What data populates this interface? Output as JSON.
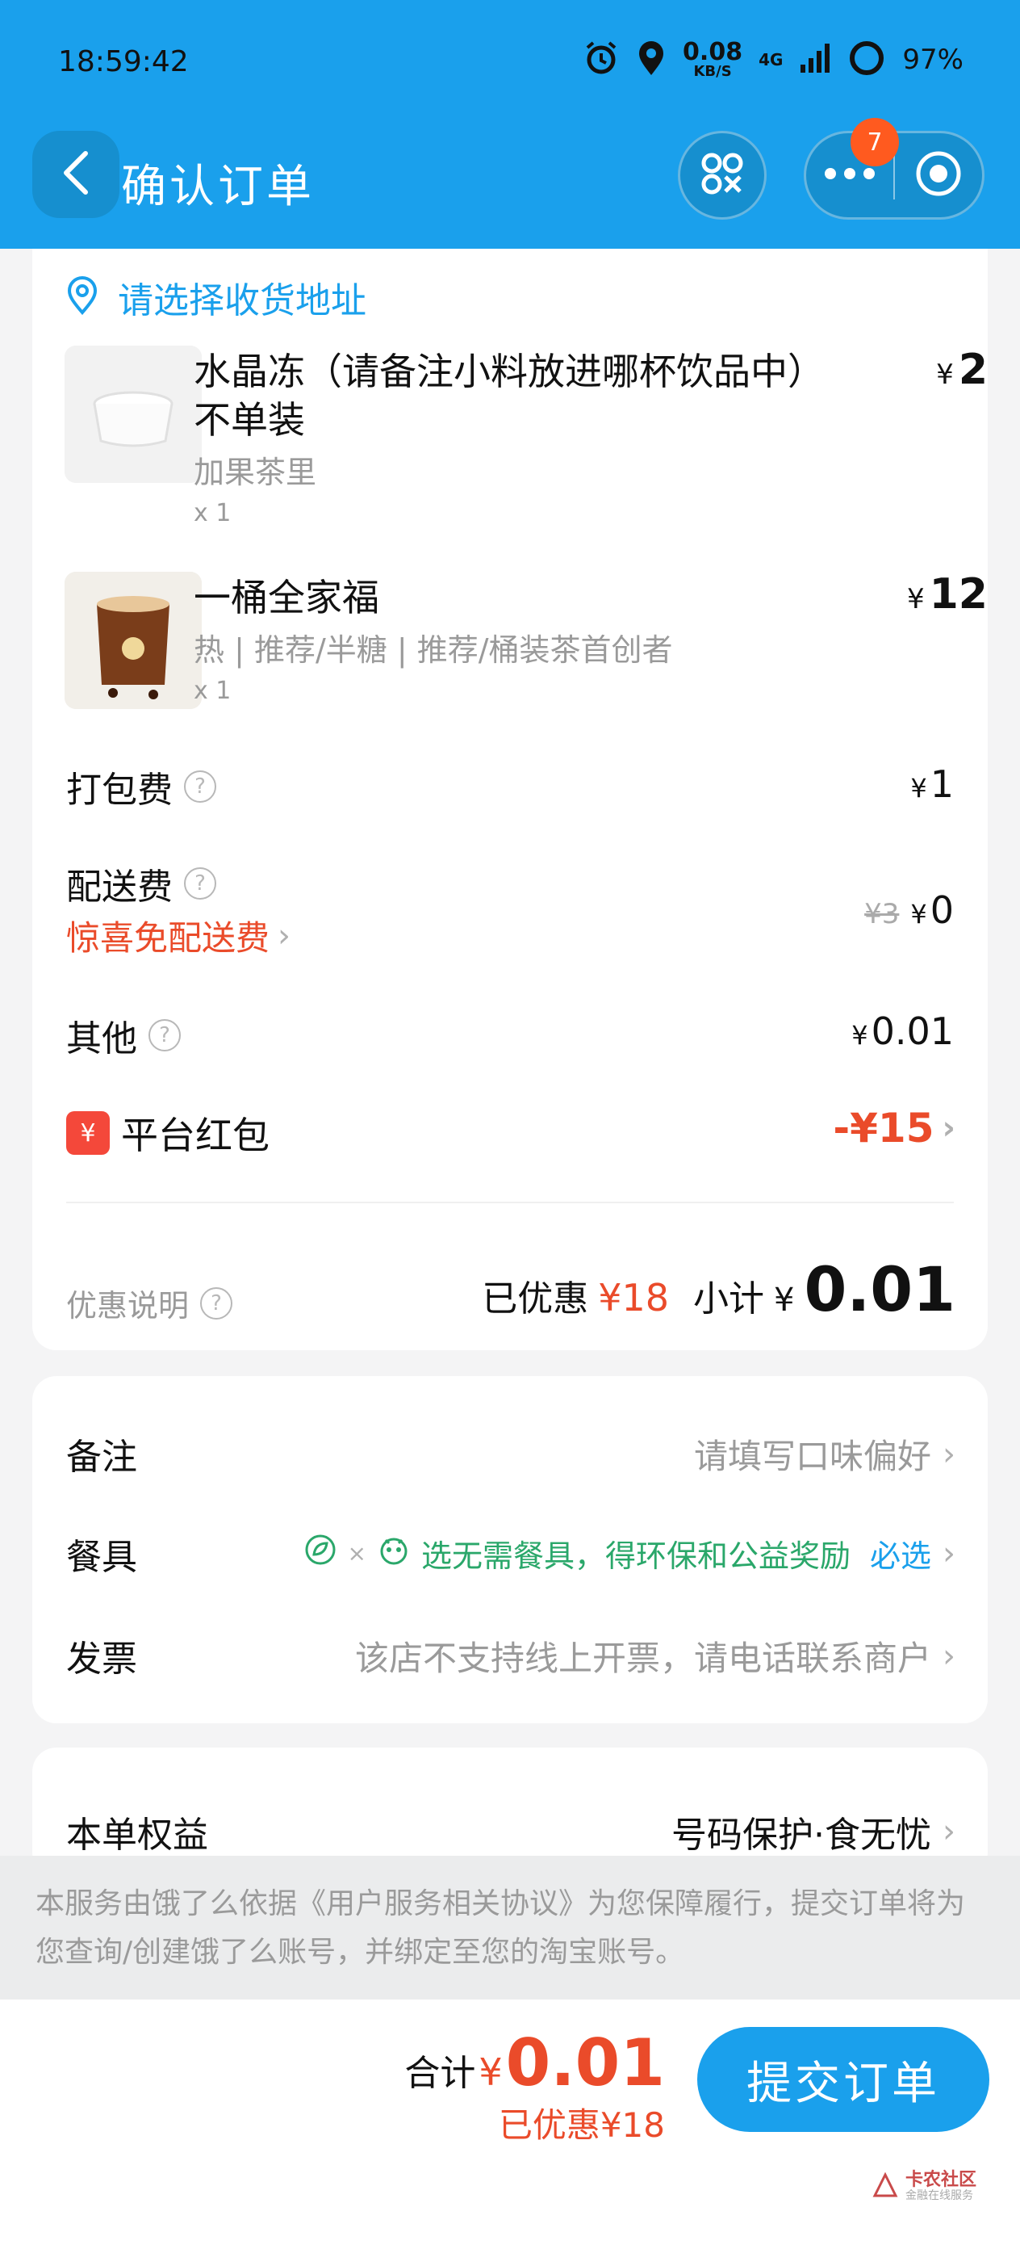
{
  "status_bar": {
    "time": "18:59:42",
    "speed_value": "0.08",
    "speed_unit": "KB/S",
    "network": "4G",
    "battery": "97%"
  },
  "header": {
    "title": "确认订单",
    "notification_count": "7",
    "icons": [
      "back-arrow-icon",
      "scan-icon",
      "more-icon",
      "record-icon"
    ],
    "color": "#1aa0ec"
  },
  "address": {
    "placeholder": "请选择收货地址"
  },
  "items": [
    {
      "name": "水晶冻（请备注小料放进哪杯饮品中）不单装",
      "spec": "加果茶里",
      "qty": "x 1",
      "price_symbol": "¥",
      "price": "2"
    },
    {
      "name": "一桶全家福",
      "spec": "热 | 推荐/半糖 | 推荐/桶装茶首创者",
      "qty": "x 1",
      "price_symbol": "¥",
      "price": "12"
    }
  ],
  "fees": {
    "packing_label": "打包费",
    "packing_value": "1",
    "delivery_label": "配送费",
    "delivery_promo": "惊喜免配送费",
    "delivery_original": "¥3",
    "delivery_value": "0",
    "other_label": "其他",
    "other_value": "0.01",
    "yen": "¥"
  },
  "red_packet": {
    "icon_text": "¥",
    "label": "平台红包",
    "value": "-¥15"
  },
  "summary": {
    "note_label": "优惠说明",
    "discount_label": "已优惠",
    "discount_value": "¥18",
    "subtotal_label": "小计",
    "subtotal_symbol": "¥",
    "subtotal_value": "0.01"
  },
  "options": {
    "remark_label": "备注",
    "remark_value": "请填写口味偏好",
    "tableware_label": "餐具",
    "tableware_value": "选无需餐具，得环保和公益奖励",
    "tableware_must": "必选",
    "invoice_label": "发票",
    "invoice_value": "该店不支持线上开票，请电话联系商户"
  },
  "benefits": {
    "label": "本单权益",
    "value": "号码保护·食无忧"
  },
  "notice": {
    "text": "本服务由饿了么依据《用户服务相关协议》为您保障履行，提交订单将为您查询/创建饿了么账号，并绑定至您的淘宝账号。"
  },
  "bottom": {
    "total_label": "合计",
    "total_symbol": "¥",
    "total_value": "0.01",
    "saved": "已优惠¥18",
    "submit_label": "提交订单"
  },
  "watermark": {
    "brand": "卡农社区",
    "sub": "金融在线服务"
  }
}
